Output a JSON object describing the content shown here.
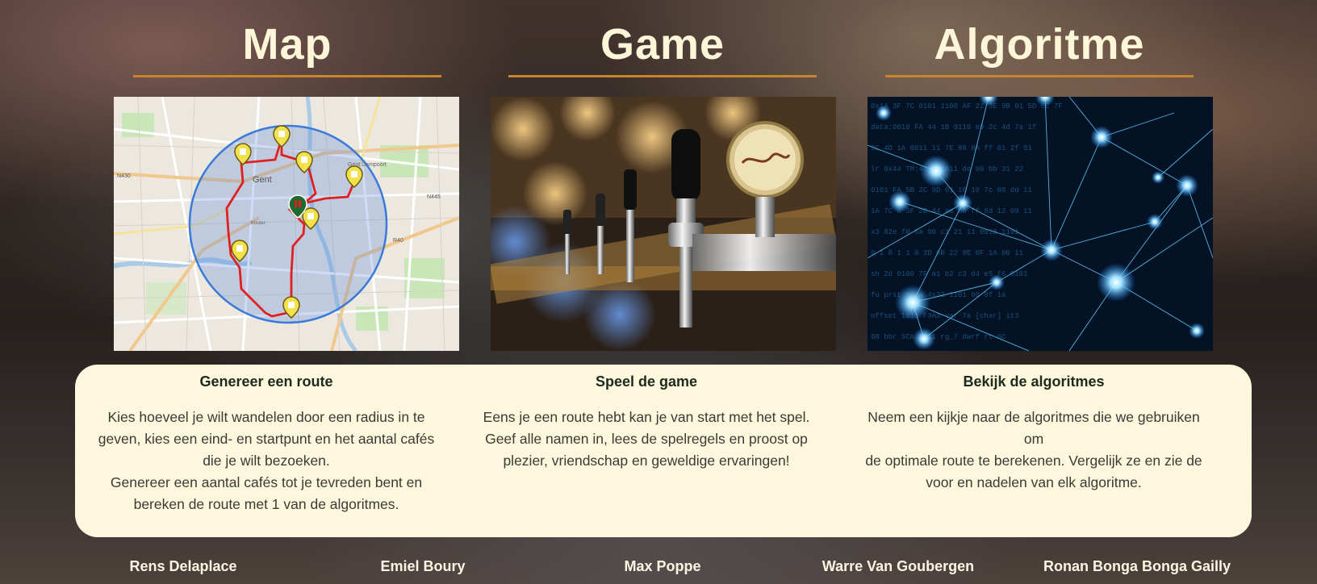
{
  "columns": [
    {
      "title": "Map",
      "image_alt": "map",
      "heading": "Genereer een route",
      "body": [
        "Kies hoeveel je wilt wandelen door een radius in te",
        "geven, kies een eind- en startpunt en het aantal cafés",
        "die je wilt bezoeken.",
        "Genereer een aantal cafés tot je tevreden bent en",
        "bereken de route met 1 van de algoritmes."
      ]
    },
    {
      "title": "Game",
      "image_alt": "beer taps",
      "heading": "Speel de game",
      "body": [
        "Eens je een route hebt kan je van start met het spel.",
        "Geef alle namen in, lees de spelregels en proost op",
        "plezier, vriendschap en geweldige ervaringen!"
      ]
    },
    {
      "title": "Algoritme",
      "image_alt": "network",
      "heading": "Bekijk de algoritmes",
      "body": [
        "Neem een kijkje naar de algoritmes die we gebruiken om",
        "de optimale route te berekenen. Vergelijk ze en zie de",
        "voor en nadelen van elk algoritme."
      ]
    }
  ],
  "map_labels": {
    "city": "Gent",
    "poi": "Gent Dampoort",
    "road1": "N430",
    "road2": "N445",
    "road3": "R40",
    "street": "Kouter"
  },
  "credits": [
    "Rens Delaplace",
    "Emiel Boury",
    "Max Poppe",
    "Warre Van Goubergen",
    "Ronan Bonga Bonga Gailly"
  ],
  "colors": {
    "title": "#fdf6d8",
    "rule": "#c9852d",
    "card": "#fdf8dd",
    "route": "#e0201f",
    "radius": "#3a7ad8"
  }
}
